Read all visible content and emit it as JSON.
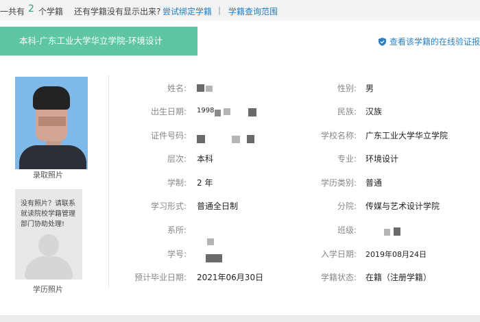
{
  "topbar": {
    "count_prefix": "一共有",
    "count": "2",
    "count_suffix": "个学籍",
    "question": "还有学籍没有显示出来?",
    "bind_link": "尝试绑定学籍",
    "separator": "|",
    "scope_link": "学籍查询范围"
  },
  "banner": {
    "title": "本科-广东工业大学华立学院-环境设计"
  },
  "verify": {
    "label": "查看该学籍的在线验证报"
  },
  "photos": {
    "admission_label": "录取照片",
    "degree_placeholder": "没有照片？请联系就读院校学籍管理部门协助处理!",
    "degree_label": "学历照片"
  },
  "left_fields": [
    {
      "label": "姓名:",
      "value": ""
    },
    {
      "label": "出生日期:",
      "value": "1998."
    },
    {
      "label": "证件号码:",
      "value": ""
    },
    {
      "label": "层次:",
      "value": "本科"
    },
    {
      "label": "学制:",
      "value": "2 年"
    },
    {
      "label": "学习形式:",
      "value": "普通全日制"
    },
    {
      "label": "系所:",
      "value": ""
    },
    {
      "label": "学号:",
      "value": ""
    },
    {
      "label": "预计毕业日期:",
      "value": "2021年06月30日"
    }
  ],
  "right_fields": [
    {
      "label": "性别:",
      "value": "男"
    },
    {
      "label": "民族:",
      "value": "汉族"
    },
    {
      "label": "学校名称:",
      "value": "广东工业大学华立学院"
    },
    {
      "label": "专业:",
      "value": "环境设计"
    },
    {
      "label": "学历类别:",
      "value": "普通"
    },
    {
      "label": "分院:",
      "value": "传媒与艺术设计学院"
    },
    {
      "label": "班级:",
      "value": ""
    },
    {
      "label": "入学日期:",
      "value": "2019年08月24日"
    },
    {
      "label": "学籍状态:",
      "value": "在籍（注册学籍）"
    }
  ],
  "colors": {
    "banner": "#5ec7a1",
    "link": "#1d7fc4",
    "accent_count": "#2aa37c"
  }
}
